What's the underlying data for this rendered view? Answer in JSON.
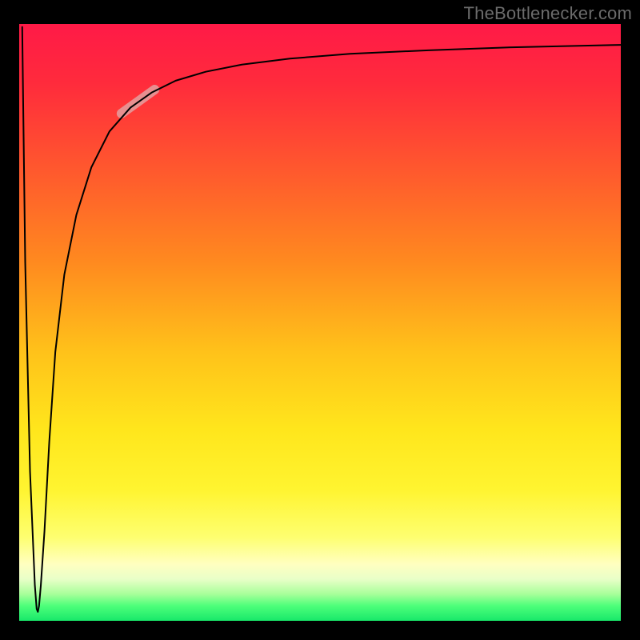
{
  "attribution": "TheBottlenecker.com",
  "chart_data": {
    "type": "line",
    "title": "",
    "xlabel": "",
    "ylabel": "",
    "xlim": [
      0,
      100
    ],
    "ylim": [
      0,
      100
    ],
    "background_gradient": {
      "orientation": "vertical",
      "stops": [
        {
          "pos": 0.0,
          "color": "#ff1a47"
        },
        {
          "pos": 0.1,
          "color": "#ff2b3c"
        },
        {
          "pos": 0.25,
          "color": "#ff5a2d"
        },
        {
          "pos": 0.4,
          "color": "#ff8a1f"
        },
        {
          "pos": 0.55,
          "color": "#ffc21a"
        },
        {
          "pos": 0.68,
          "color": "#ffe61c"
        },
        {
          "pos": 0.78,
          "color": "#fff430"
        },
        {
          "pos": 0.86,
          "color": "#feff70"
        },
        {
          "pos": 0.905,
          "color": "#ffffc0"
        },
        {
          "pos": 0.93,
          "color": "#e9ffc8"
        },
        {
          "pos": 0.955,
          "color": "#a8ff9a"
        },
        {
          "pos": 0.975,
          "color": "#4dff7a"
        },
        {
          "pos": 1.0,
          "color": "#18e86a"
        }
      ]
    },
    "series": [
      {
        "name": "bottleneck-curve",
        "color": "#000000",
        "stroke_width": 2,
        "x": [
          0.5,
          1.0,
          1.8,
          2.6,
          2.9,
          3.1,
          3.3,
          3.6,
          4.2,
          5.0,
          6.0,
          7.5,
          9.5,
          12.0,
          15.0,
          18.5,
          22.0,
          26.0,
          31.0,
          37.0,
          45.0,
          55.0,
          68.0,
          82.0,
          100.0
        ],
        "y": [
          99.5,
          60.0,
          25.0,
          6.0,
          2.0,
          1.5,
          2.5,
          6.0,
          15.0,
          30.0,
          45.0,
          58.0,
          68.0,
          76.0,
          82.0,
          86.0,
          88.5,
          90.5,
          92.0,
          93.2,
          94.2,
          95.0,
          95.6,
          96.1,
          96.5
        ]
      }
    ],
    "highlight_segment": {
      "name": "curve-highlight",
      "color": "#e3a0a0",
      "opacity": 0.85,
      "stroke_width": 12,
      "x_start": 17.0,
      "y_start": 85.0,
      "x_end": 22.5,
      "y_end": 89.0
    }
  }
}
